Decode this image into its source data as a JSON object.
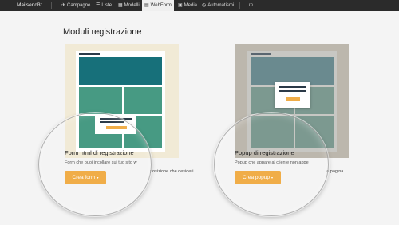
{
  "navbar": {
    "brand": "Mailsend3r",
    "items": [
      {
        "label": "Campagne",
        "icon": "✈"
      },
      {
        "label": "Liste",
        "icon": "☰"
      },
      {
        "label": "Modelli",
        "icon": "▦"
      },
      {
        "label": "WebForm",
        "icon": "▤"
      },
      {
        "label": "Media",
        "icon": "▣"
      },
      {
        "label": "Automatismi",
        "icon": "◷"
      },
      {
        "label": "",
        "icon": "⏻"
      }
    ]
  },
  "page": {
    "title": "Moduli registrazione"
  },
  "cards": [
    {
      "title": "Form html di registrazione",
      "description": "Form che puoi incollare sul tuo sito w",
      "description_tail": "posizione che desideri.",
      "button": "Crea form",
      "caret": "▾"
    },
    {
      "title": "Popup di registrazione",
      "description": "Popup che appare al cliente non appe",
      "description_tail": "la pagina.",
      "button": "Crea popup",
      "caret": "▾"
    }
  ]
}
